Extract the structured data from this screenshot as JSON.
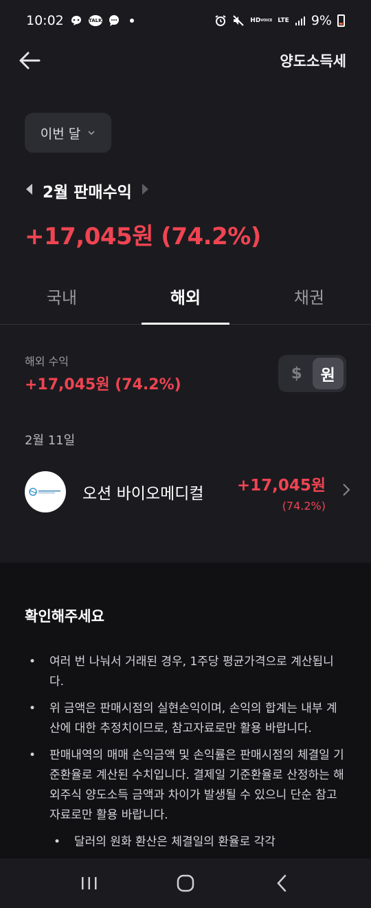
{
  "status_bar": {
    "time": "10:02",
    "talk_label": "TALK",
    "hd_label": "HD",
    "voice_label": "VOICE",
    "lte_label": "LTE",
    "battery": "9%",
    "icons": [
      "chat-bubble-icon",
      "kakaotalk-icon",
      "message-icon",
      "alarm-icon",
      "mute-icon",
      "signal-icon",
      "battery-icon"
    ]
  },
  "header": {
    "title": "양도소득세",
    "back_icon": "arrow-left-icon"
  },
  "period": {
    "selected": "이번 달",
    "icon": "chevron-down-icon"
  },
  "month": {
    "label": "2월 판매수익"
  },
  "total": {
    "profit": "+17,045원 (74.2%)"
  },
  "tabs": [
    {
      "label": "국내",
      "active": false
    },
    {
      "label": "해외",
      "active": true
    },
    {
      "label": "채권",
      "active": false
    }
  ],
  "overseas": {
    "label": "해외 수익",
    "value": "+17,045원 (74.2%)",
    "currency_options": [
      "$",
      "원"
    ],
    "currency_selected": "원"
  },
  "trades": {
    "date": "2월 11일",
    "items": [
      {
        "name": "오션 바이오메디컬",
        "amount": "+17,045원",
        "percent": "(74.2%)"
      }
    ]
  },
  "notice": {
    "title": "확인해주세요",
    "items": [
      "여러 번 나눠서 거래된 경우, 1주당 평균가격으로 계산됩니다.",
      "위 금액은 판매시점의 실현손익이며, 손익의 합계는 내부 계산에 대한 추정치이므로, 참고자료로만 활용 바랍니다.",
      "판매내역의 매매 손익금액 및 손익률은 판매시점의 체결일 기준환율로 계산된 수치입니다. 결제일 기준환율로 산정하는 해외주식 양도소득 금액과 차이가 발생될 수 있으니 단순 참고자료로만 활용 바랍니다."
    ],
    "sub_item": "달러의 원화 환산은 체결일의 환율로 각각"
  },
  "colors": {
    "background": "#1b1b1f",
    "profit_red": "#f04452",
    "notice_bg": "#111114"
  }
}
